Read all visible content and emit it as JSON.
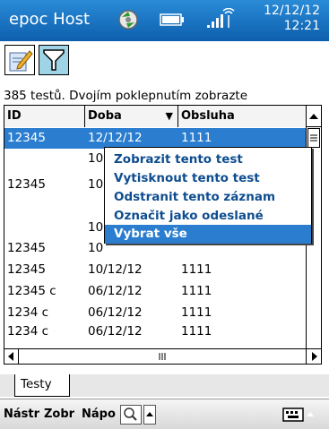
{
  "titlebar": {
    "title": "epoc Host",
    "date": "12/12/12",
    "time": "12:21",
    "icons": [
      "sync-icon",
      "battery-icon",
      "signal-icon"
    ]
  },
  "toolbar": {
    "buttons": [
      {
        "name": "edit-icon",
        "active": false
      },
      {
        "name": "filter-icon",
        "active": true
      }
    ]
  },
  "hint": "385 testů. Dvojím poklepnutím zobrazte",
  "table": {
    "columns": [
      {
        "label": "ID"
      },
      {
        "label": "Doba"
      },
      {
        "label": "Obsluha"
      }
    ],
    "sort_indicator": "▼",
    "rows": [
      {
        "id": "12345",
        "doba": "12/12/12",
        "obsluha": "1111",
        "selected": true
      },
      {
        "id": "",
        "doba": "10",
        "obsluha": "",
        "selected": false
      },
      {
        "id": "12345",
        "doba": "10",
        "obsluha": "",
        "selected": false
      },
      {
        "id": "",
        "doba": "10",
        "obsluha": "",
        "selected": false
      },
      {
        "id": "12345",
        "doba": "10",
        "obsluha": "",
        "selected": false
      },
      {
        "id": "12345",
        "doba": "10/12/12",
        "obsluha": "1111",
        "selected": false
      },
      {
        "id": "12345 c",
        "doba": "06/12/12",
        "obsluha": "1111",
        "selected": false
      },
      {
        "id": "1234 c",
        "doba": "06/12/12",
        "obsluha": "1111",
        "selected": false
      },
      {
        "id": "1234 c",
        "doba": "06/12/12",
        "obsluha": "1111",
        "selected": false
      }
    ]
  },
  "context_menu": {
    "items": [
      {
        "label": "Zobrazit tento test",
        "highlighted": false
      },
      {
        "label": "Vytisknout tento test",
        "highlighted": false
      },
      {
        "label": "Odstranit tento záznam",
        "highlighted": false
      },
      {
        "label": "Označit jako odeslané",
        "highlighted": false
      },
      {
        "label": "Vybrat vše",
        "highlighted": true
      }
    ]
  },
  "tabs": [
    {
      "label": "Testy"
    }
  ],
  "menubar": {
    "items": [
      "Nástr",
      "Zobr",
      "Nápo"
    ],
    "search_icon": "search-icon",
    "up_icon": "arrow-up-icon",
    "keyboard_icon": "keyboard-icon"
  },
  "colors": {
    "title_bg": "#1a74c4",
    "selection": "#2a7dcf",
    "menu_text": "#0e4d8f",
    "filter_active": "#9ed4e6"
  }
}
